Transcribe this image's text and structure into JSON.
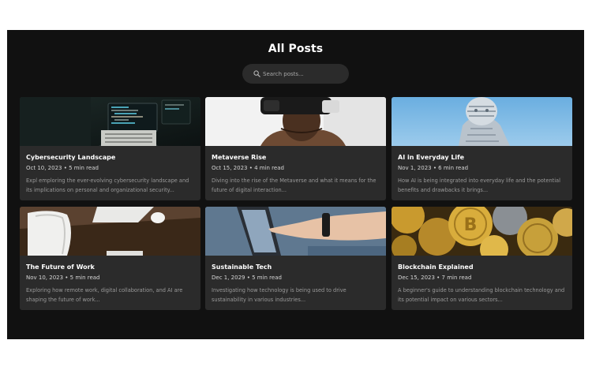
{
  "page": {
    "title": "All Posts",
    "search_placeholder": "Search posts..."
  },
  "colors": {
    "background": "#111111",
    "card": "#2b2b2b",
    "search": "#2b2b2b",
    "title_text": "#ffffff",
    "meta_text": "#d6d6d6",
    "excerpt_text": "#9a9a9a"
  },
  "posts": [
    {
      "title": "Cybersecurity Landscape",
      "date": "Oct 10, 2023",
      "read_time": "5 min read",
      "meta": "Oct 10, 2023 • 5 min read",
      "excerpt": "Expl emploring the ever-evolving cybersecurity landscape and its implications on personal and organizational security...",
      "image": "laptop-code-photo"
    },
    {
      "title": "Metaverse Rise",
      "date": "Oct 15, 2023",
      "read_time": "4 min read",
      "meta": "Oct 15, 2023 • 4 min read",
      "excerpt": "Diving into the rise of the Metaverse and what it means for the future of digital interaction...",
      "image": "vr-headset-photo"
    },
    {
      "title": "AI in Everyday Life",
      "date": "Nov 1, 2023",
      "read_time": "6 min read",
      "meta": "Nov 1, 2023 • 6 min read",
      "excerpt": "How AI is being integrated into everyday life and the potential benefits and drawbacks it brings...",
      "image": "robot-figure-photo"
    },
    {
      "title": "The Future of Work",
      "date": "Nov 10, 2023",
      "read_time": "5 min read",
      "meta": "Nov 10, 2023 • 5 min read",
      "excerpt": "Exploring how remote work, digital collaboration, and AI are shaping the future of work...",
      "image": "desk-mouse-photo"
    },
    {
      "title": "Sustainable Tech",
      "date": "Dec 1, 2029",
      "read_time": "5 min read",
      "meta": "Dec 1, 2029 • 5 min read",
      "excerpt": "Investigating how technology is being used to drive sustainability in various industries...",
      "image": "hand-pointing-photo"
    },
    {
      "title": "Blockchain Explained",
      "date": "Dec 15, 2023",
      "read_time": "7 min read",
      "meta": "Dec 15, 2023 • 7 min read",
      "excerpt": "A beginner's guide to understanding blockchain technology and its potential impact on various sectors...",
      "image": "gold-coins-photo"
    }
  ]
}
